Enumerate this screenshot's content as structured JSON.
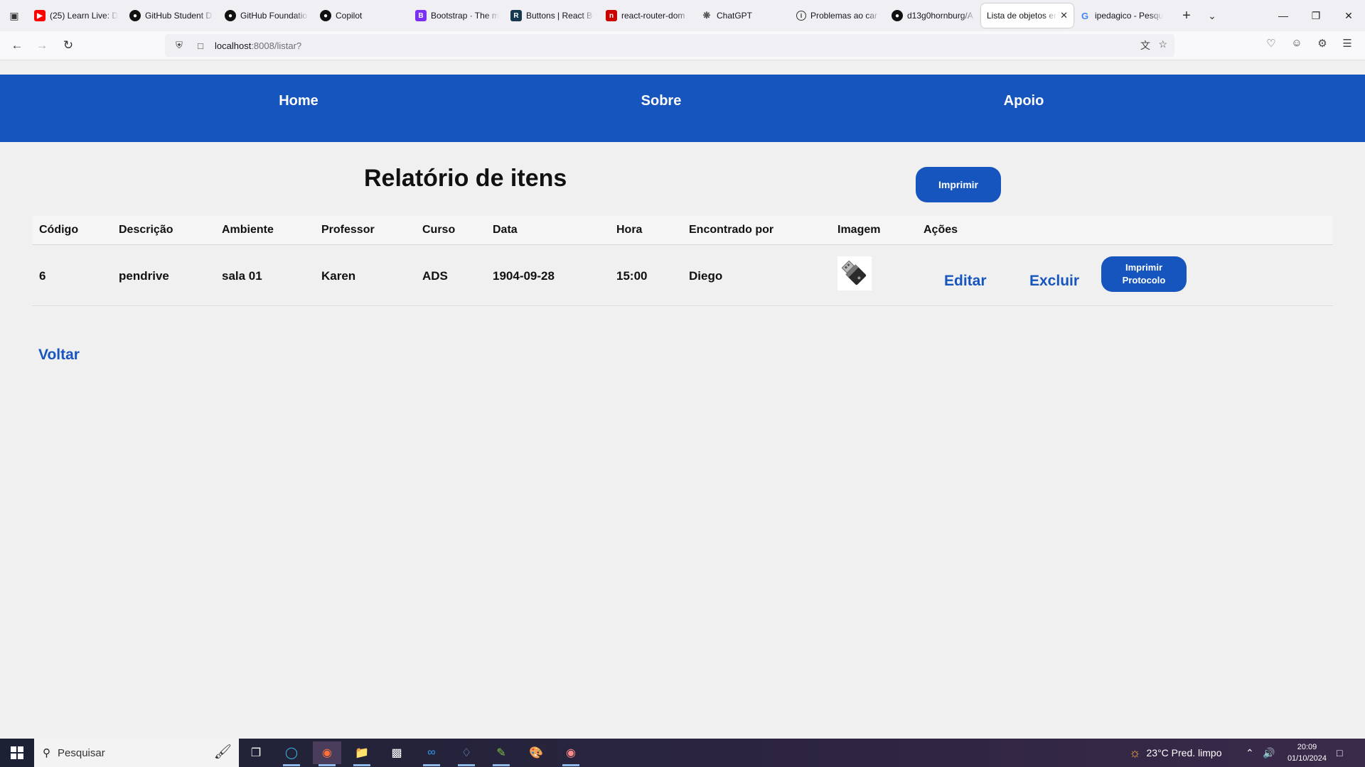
{
  "browser": {
    "tabs": [
      {
        "label": "(25) Learn Live: D",
        "icon": "youtube-icon",
        "color": "#ff0000"
      },
      {
        "label": "GitHub Student D",
        "icon": "github-icon",
        "color": "#111111"
      },
      {
        "label": "GitHub Foundatio",
        "icon": "github-icon",
        "color": "#111111"
      },
      {
        "label": "Copilot",
        "icon": "github-icon",
        "color": "#111111"
      },
      {
        "label": "Bootstrap · The m",
        "icon": "bootstrap-icon",
        "color": "#7b2ff7"
      },
      {
        "label": "Buttons | React B",
        "icon": "react-bootstrap-icon",
        "color": "#17394f"
      },
      {
        "label": "react-router-dom",
        "icon": "npm-icon",
        "color": "#cb0000"
      },
      {
        "label": "ChatGPT",
        "icon": "chatgpt-icon",
        "color": "#555555"
      },
      {
        "label": "Problemas ao car",
        "icon": "info-icon",
        "color": "#333333"
      },
      {
        "label": "d13g0hornburg/A",
        "icon": "github-icon",
        "color": "#111111"
      },
      {
        "label": "Lista de objetos en",
        "icon": "",
        "color": "",
        "active": true
      },
      {
        "label": "ipedagico - Pesqu",
        "icon": "google-icon",
        "color": "#4285f4"
      }
    ],
    "url_host": "localhost",
    "url_path": ":8008/listar?"
  },
  "site": {
    "nav": {
      "home": "Home",
      "sobre": "Sobre",
      "apoio": "Apoio"
    },
    "title": "Relatório de itens",
    "print_label": "Imprimir",
    "table": {
      "headers": [
        "Código",
        "Descrição",
        "Ambiente",
        "Professor",
        "Curso",
        "Data",
        "Hora",
        "Encontrado por",
        "Imagem",
        "Ações"
      ],
      "rows": [
        {
          "codigo": "6",
          "descricao": "pendrive",
          "ambiente": "sala 01",
          "professor": "Karen",
          "curso": "ADS",
          "data": "1904-09-28",
          "hora": "15:00",
          "encontrado_por": "Diego",
          "imagem": "usb-flash-drive-image",
          "actions": {
            "edit": "Editar",
            "delete": "Excluir",
            "protocol_line1": "Imprimir",
            "protocol_line2": "Protocolo"
          }
        }
      ]
    },
    "back_label": "Voltar"
  },
  "taskbar": {
    "search_placeholder": "Pesquisar",
    "weather": "23°C  Pred. limpo",
    "time": "20:09",
    "date": "01/10/2024"
  }
}
